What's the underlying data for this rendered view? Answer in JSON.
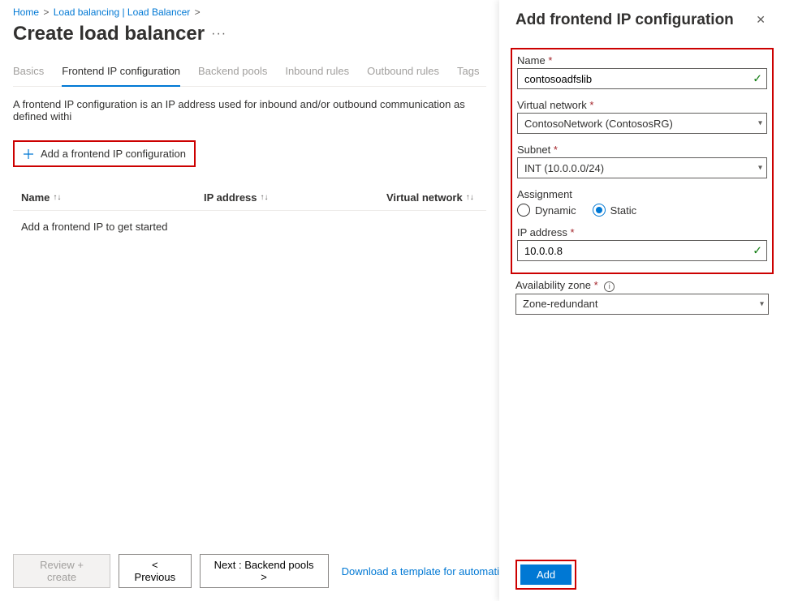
{
  "breadcrumb": {
    "home": "Home",
    "lb_list": "Load balancing | Load Balancer"
  },
  "page_title": "Create load balancer",
  "tabs": {
    "basics": "Basics",
    "frontend": "Frontend IP configuration",
    "backend": "Backend pools",
    "inbound": "Inbound rules",
    "outbound": "Outbound rules",
    "tags": "Tags"
  },
  "description": "A frontend IP configuration is an IP address used for inbound and/or outbound communication as defined withi",
  "add_frontend_button": "Add a frontend IP configuration",
  "columns": {
    "name": "Name",
    "ip": "IP address",
    "vnet": "Virtual network"
  },
  "empty_row": "Add a frontend IP to get started",
  "footer": {
    "review": "Review + create",
    "previous": "< Previous",
    "next": "Next : Backend pools >",
    "template_link": "Download a template for automati"
  },
  "panel": {
    "title": "Add frontend IP configuration",
    "name_label": "Name",
    "name_value": "contosoadfslib",
    "vnet_label": "Virtual network",
    "vnet_value": "ContosoNetwork (ContososRG)",
    "subnet_label": "Subnet",
    "subnet_value": "INT (10.0.0.0/24)",
    "assignment_label": "Assignment",
    "assignment_dynamic": "Dynamic",
    "assignment_static": "Static",
    "ip_label": "IP address",
    "ip_value": "10.0.0.8",
    "az_label": "Availability zone",
    "az_value": "Zone-redundant",
    "add": "Add"
  }
}
